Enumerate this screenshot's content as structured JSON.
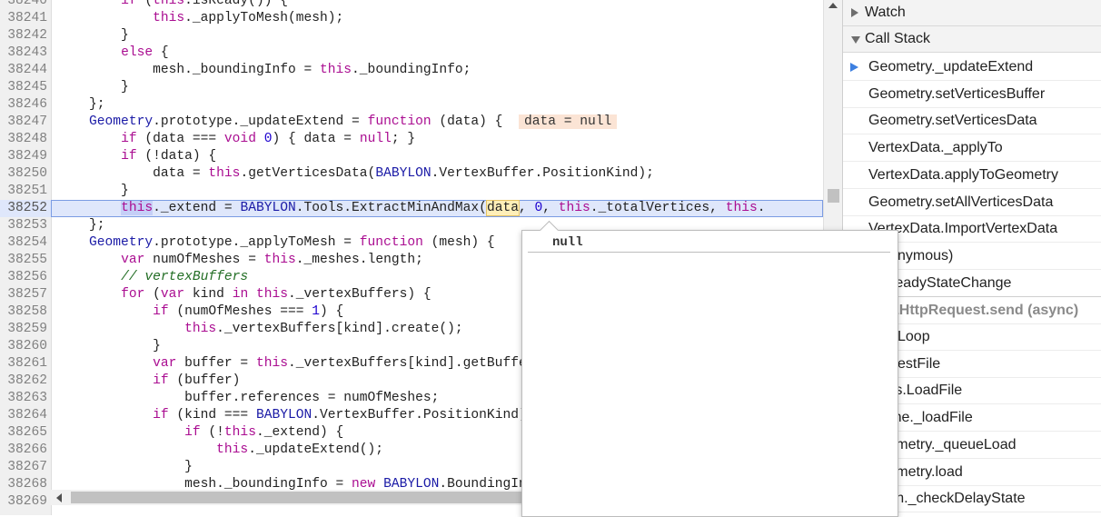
{
  "editor": {
    "lines": [
      {
        "n": "38240",
        "code": "        if (this.isReady()) {"
      },
      {
        "n": "38241",
        "code": "            this._applyToMesh(mesh);"
      },
      {
        "n": "38242",
        "code": "        }"
      },
      {
        "n": "38243",
        "code": "        else {"
      },
      {
        "n": "38244",
        "code": "            mesh._boundingInfo = this._boundingInfo;"
      },
      {
        "n": "38245",
        "code": "        }"
      },
      {
        "n": "38246",
        "code": "    };"
      },
      {
        "n": "38247",
        "code": "    Geometry.prototype._updateExtend = function (data) {  "
      },
      {
        "n": "38248",
        "code": "        if (data === void 0) { data = null; }"
      },
      {
        "n": "38249",
        "code": "        if (!data) {"
      },
      {
        "n": "38250",
        "code": "            data = this.getVerticesData(BABYLON.VertexBuffer.PositionKind);"
      },
      {
        "n": "38251",
        "code": "        }"
      },
      {
        "n": "38252",
        "code": "        this._extend = BABYLON.Tools.ExtractMinAndMax(data, 0, this._totalVertices, this."
      },
      {
        "n": "38253",
        "code": "    };"
      },
      {
        "n": "38254",
        "code": "    Geometry.prototype._applyToMesh = function (mesh) {"
      },
      {
        "n": "38255",
        "code": "        var numOfMeshes = this._meshes.length;"
      },
      {
        "n": "38256",
        "code": "        // vertexBuffers"
      },
      {
        "n": "38257",
        "code": "        for (var kind in this._vertexBuffers) {"
      },
      {
        "n": "38258",
        "code": "            if (numOfMeshes === 1) {"
      },
      {
        "n": "38259",
        "code": "                this._vertexBuffers[kind].create();"
      },
      {
        "n": "38260",
        "code": "            }"
      },
      {
        "n": "38261",
        "code": "            var buffer = this._vertexBuffers[kind].getBuffer();"
      },
      {
        "n": "38262",
        "code": "            if (buffer)"
      },
      {
        "n": "38263",
        "code": "                buffer.references = numOfMeshes;"
      },
      {
        "n": "38264",
        "code": "            if (kind === BABYLON.VertexBuffer.PositionKind) {"
      },
      {
        "n": "38265",
        "code": "                if (!this._extend) {"
      },
      {
        "n": "38266",
        "code": "                    this._updateExtend();"
      },
      {
        "n": "38267",
        "code": "                }"
      },
      {
        "n": "38268",
        "code": "                mesh._boundingInfo = new BABYLON.BoundingInfo("
      },
      {
        "n": "38269",
        "code": ""
      }
    ],
    "inline_value": "data = null",
    "highlight_line": "38252"
  },
  "popover": {
    "value": "null"
  },
  "sidebar": {
    "watch_label": "Watch",
    "callstack_label": "Call Stack",
    "frames": [
      {
        "label": "Geometry._updateExtend",
        "current": true
      },
      {
        "label": "Geometry.setVerticesBuffer"
      },
      {
        "label": "Geometry.setVerticesData"
      },
      {
        "label": "VertexData._applyTo"
      },
      {
        "label": "VertexData.applyToGeometry"
      },
      {
        "label": "Geometry.setAllVerticesData"
      },
      {
        "label": "VertexData.ImportVertexData"
      },
      {
        "label": "(anonymous)"
      },
      {
        "label": "onReadyStateChange"
      },
      {
        "label": "XMLHttpRequest.send (async)",
        "async": true
      },
      {
        "label": "retryLoop"
      },
      {
        "label": "requestFile"
      },
      {
        "label": "Tools.LoadFile"
      },
      {
        "label": "Scene._loadFile"
      },
      {
        "label": "Geometry._queueLoad"
      },
      {
        "label": "Geometry.load"
      },
      {
        "label": "Mesh._checkDelayState"
      }
    ]
  },
  "colors": {
    "highlight_bg": "#dfe7fb",
    "keyword": "#aa0d91",
    "current_frame_arrow": "#3c7fe0"
  }
}
